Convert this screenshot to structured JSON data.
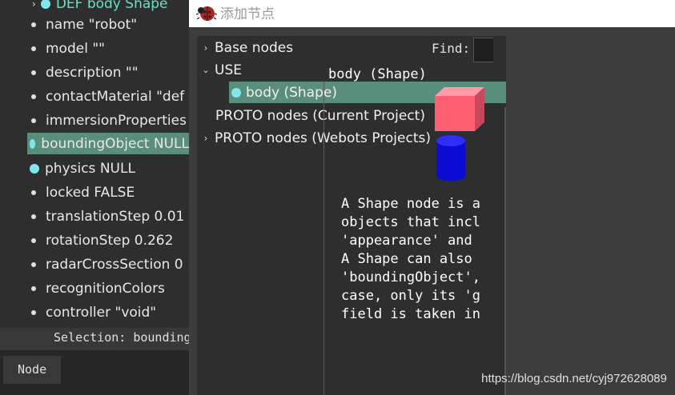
{
  "scene_tree": {
    "top_item": "DEF body Shape",
    "items": [
      {
        "label": "name \"robot\"",
        "marker": "bullet"
      },
      {
        "label": "model \"\"",
        "marker": "bullet"
      },
      {
        "label": "description \"\"",
        "marker": "bullet"
      },
      {
        "label": "contactMaterial \"def",
        "marker": "bullet"
      },
      {
        "label": "immersionProperties",
        "marker": "bullet"
      },
      {
        "label": "boundingObject NULL",
        "marker": "cyan"
      },
      {
        "label": "physics NULL",
        "marker": "cyan"
      },
      {
        "label": "locked FALSE",
        "marker": "bullet"
      },
      {
        "label": "translationStep 0.01",
        "marker": "bullet"
      },
      {
        "label": "rotationStep 0.262",
        "marker": "bullet"
      },
      {
        "label": "radarCrossSection 0",
        "marker": "bullet"
      },
      {
        "label": "recognitionColors",
        "marker": "bullet"
      },
      {
        "label": "controller \"void\"",
        "marker": "bullet"
      }
    ],
    "selection_text": "Selection: boundingObject",
    "node_tab": "Node"
  },
  "dialog": {
    "title": "添加节点",
    "list": {
      "base_nodes": "Base nodes",
      "use": "USE",
      "use_child": "body (Shape)",
      "proto_current": "PROTO nodes (Current Project)",
      "proto_webots": "PROTO nodes (Webots Projects)"
    },
    "find_label": "Find:",
    "find_value": "",
    "preview_title": "body (Shape)",
    "description_lines": [
      "A Shape node is a",
      "objects that incl",
      "'appearance' and",
      "A Shape can also",
      "'boundingObject',",
      "case, only its 'g",
      "field is taken in"
    ]
  },
  "watermark": "https://blog.csdn.net/cyj972628089",
  "colors": {
    "highlight": "#5a8e7c",
    "cyan_marker": "#7fe7ee",
    "top_item": "#62e3c5"
  }
}
